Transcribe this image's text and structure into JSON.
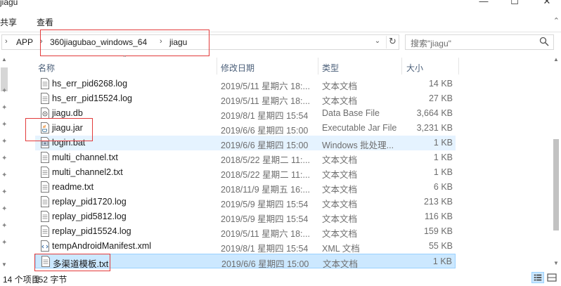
{
  "window": {
    "title": "jiagu",
    "minimize": "—",
    "maximize": "☐",
    "close": "✕"
  },
  "ribbon": {
    "tabs": [
      "共享",
      "查看"
    ],
    "collapse": "⌃"
  },
  "address": {
    "crumbs": [
      "APP",
      "360jiagubao_windows_64",
      "jiagu"
    ],
    "separator": "›",
    "dropdown": "⌄",
    "refresh": "↻"
  },
  "search": {
    "placeholder": "搜索\"jiagu\""
  },
  "columns": {
    "name": "名称",
    "date": "修改日期",
    "type": "类型",
    "size": "大小"
  },
  "files": [
    {
      "name": "hs_err_pid6268.log",
      "date": "2019/5/11 星期六 18:...",
      "type": "文本文档",
      "size": "14 KB",
      "icon": "text-file-icon"
    },
    {
      "name": "hs_err_pid15524.log",
      "date": "2019/5/11 星期六 18:...",
      "type": "文本文档",
      "size": "27 KB",
      "icon": "text-file-icon"
    },
    {
      "name": "jiagu.db",
      "date": "2019/8/1 星期四 15:54",
      "type": "Data Base File",
      "size": "3,664 KB",
      "icon": "database-file-icon"
    },
    {
      "name": "jiagu.jar",
      "date": "2019/6/6 星期四 15:00",
      "type": "Executable Jar File",
      "size": "3,231 KB",
      "icon": "java-jar-icon"
    },
    {
      "name": "login.bat",
      "date": "2019/6/6 星期四 15:00",
      "type": "Windows 批处理...",
      "size": "1 KB",
      "icon": "batch-file-icon"
    },
    {
      "name": "multi_channel.txt",
      "date": "2018/5/22 星期二 11:...",
      "type": "文本文档",
      "size": "1 KB",
      "icon": "text-file-icon"
    },
    {
      "name": "multi_channel2.txt",
      "date": "2018/5/22 星期二 11:...",
      "type": "文本文档",
      "size": "1 KB",
      "icon": "text-file-icon"
    },
    {
      "name": "readme.txt",
      "date": "2018/11/9 星期五 16:...",
      "type": "文本文档",
      "size": "6 KB",
      "icon": "text-file-icon"
    },
    {
      "name": "replay_pid1720.log",
      "date": "2019/5/9 星期四 15:54",
      "type": "文本文档",
      "size": "213 KB",
      "icon": "text-file-icon"
    },
    {
      "name": "replay_pid5812.log",
      "date": "2019/5/9 星期四 15:54",
      "type": "文本文档",
      "size": "116 KB",
      "icon": "text-file-icon"
    },
    {
      "name": "replay_pid15524.log",
      "date": "2019/5/11 星期六 18:...",
      "type": "文本文档",
      "size": "159 KB",
      "icon": "text-file-icon"
    },
    {
      "name": "tempAndroidManifest.xml",
      "date": "2019/8/1 星期四 15:54",
      "type": "XML 文档",
      "size": "55 KB",
      "icon": "xml-file-icon"
    },
    {
      "name": "多渠道模板.txt",
      "date": "2019/6/6 星期四 15:00",
      "type": "文本文档",
      "size": "1 KB",
      "icon": "text-file-icon"
    }
  ],
  "status": {
    "count_label": "14 个项目",
    "selected_label": "152 字节"
  },
  "colors": {
    "highlight_red": "#e23b3b",
    "selection_bg": "#cce8ff",
    "hover_bg": "#e5f3ff"
  }
}
